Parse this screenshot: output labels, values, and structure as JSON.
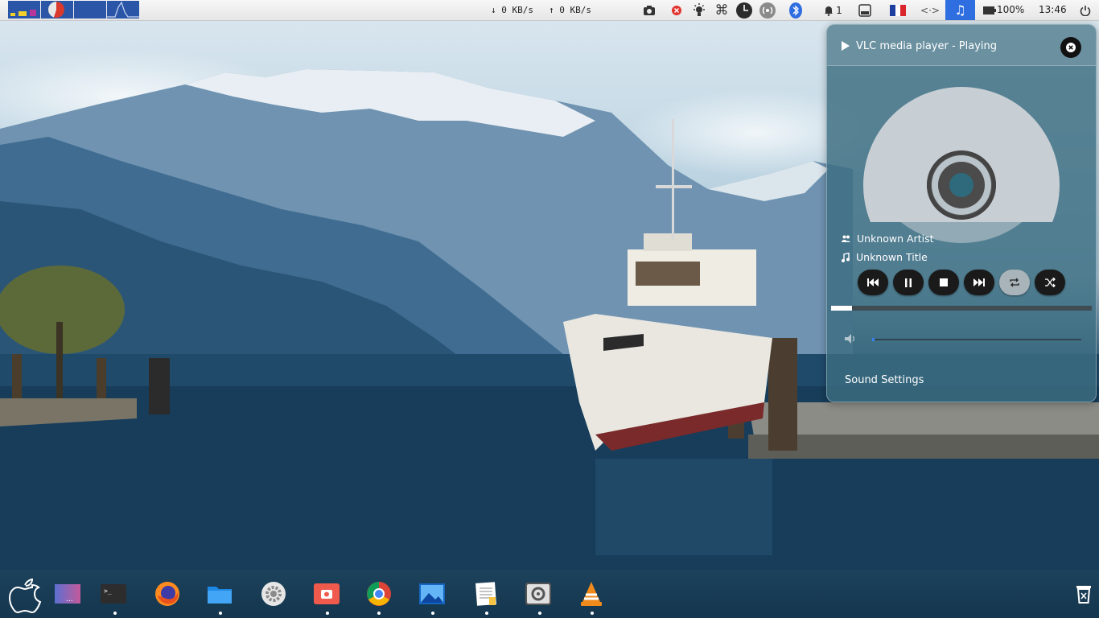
{
  "top_panel": {
    "workspaces": [
      "workspace-1",
      "workspace-2",
      "workspace-3",
      "workspace-4"
    ],
    "net_down": "↓ 0 KB/s",
    "net_up": "↑ 0 KB/s",
    "indicator_badge": "1",
    "battery": "100%",
    "clock": "13:46",
    "icons": [
      "screenshot-icon",
      "close-red-icon",
      "brightness-icon",
      "command-icon",
      "clock-icon",
      "broadcast-icon",
      "bluetooth-icon",
      "notification-icon",
      "storage-icon",
      "flag-fr-icon",
      "network-icon",
      "music-note-icon",
      "battery-icon",
      "power-icon"
    ]
  },
  "vlc": {
    "header": "VLC media player - Playing",
    "artist": "Unknown Artist",
    "title": "Unknown Title",
    "controls": [
      "previous",
      "pause",
      "stop",
      "next",
      "repeat",
      "shuffle"
    ],
    "progress_fraction": 0.08,
    "volume_fraction": 0.01,
    "sound_settings": "Sound Settings"
  },
  "dock": {
    "items": [
      "apple-icon",
      "workspace-preview",
      "terminal",
      "firefox",
      "files",
      "settings-gear",
      "screenshot-app",
      "chrome",
      "image-viewer",
      "text-editor",
      "system-settings",
      "vlc"
    ],
    "trash": "trash-icon",
    "colors": {
      "vlc_orange": "#f08a1c",
      "accent_blue": "#2f6ee0"
    }
  }
}
